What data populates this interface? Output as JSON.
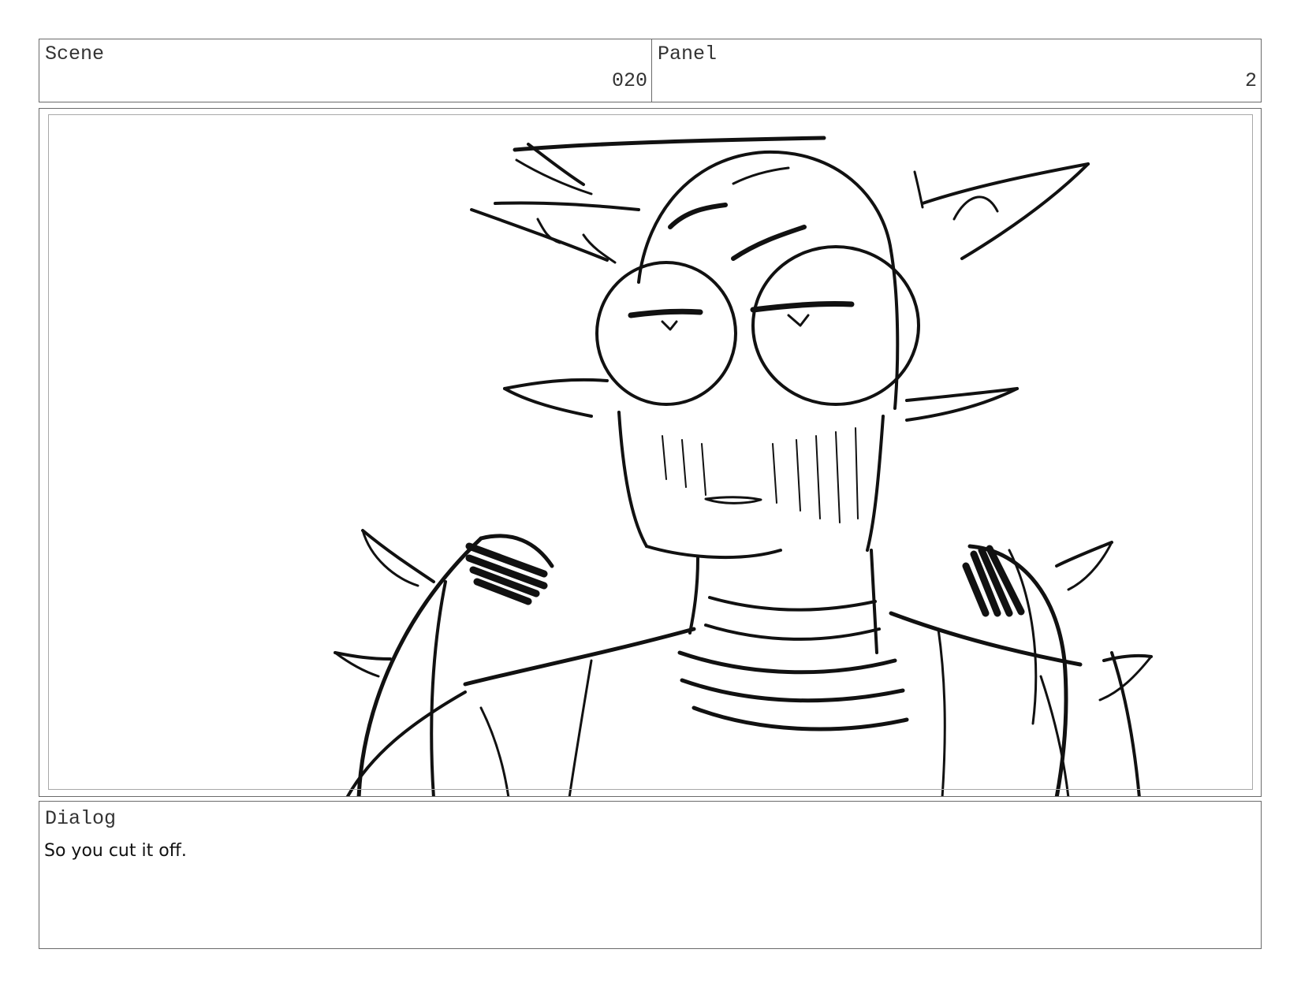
{
  "header": {
    "scene_label": "Scene",
    "scene_value": "020",
    "panel_label": "Panel",
    "panel_value": "2"
  },
  "frame": {
    "image_alt": "storyboard-sketch",
    "line_color": "#111111"
  },
  "dialog": {
    "label": "Dialog",
    "text": "So you cut it off."
  }
}
